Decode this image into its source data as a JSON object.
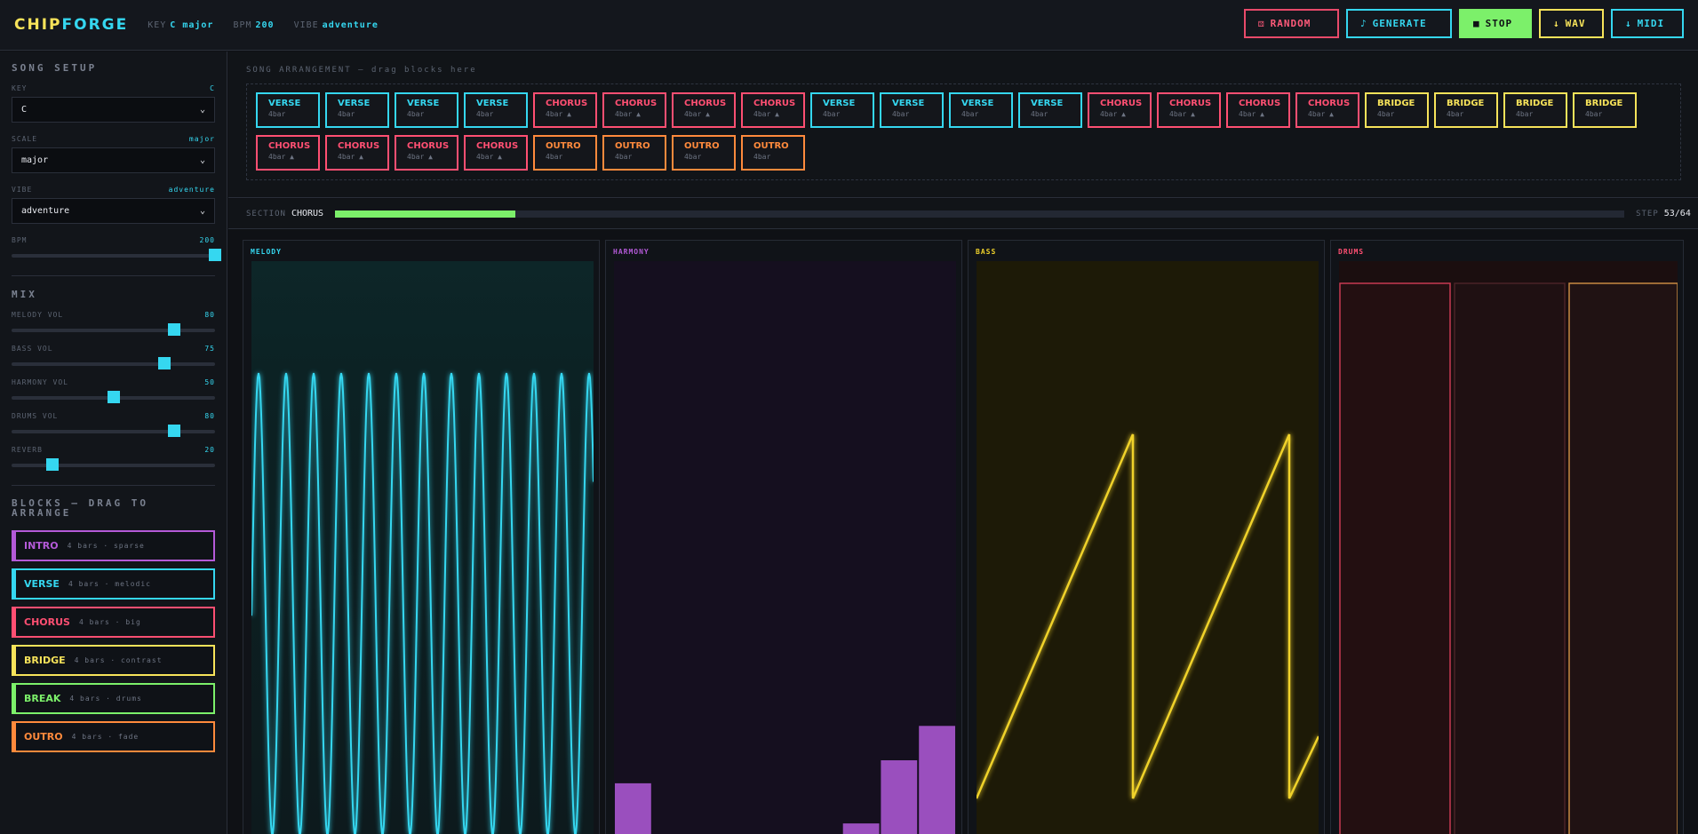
{
  "header": {
    "logo_a": "CHIP",
    "logo_b": "FORGE",
    "key_label": "KEY",
    "key_value": "C major",
    "bpm_label": "BPM",
    "bpm_value": "200",
    "vibe_label": "VIBE",
    "vibe_value": "adventure",
    "buttons": {
      "random": {
        "icon": "⚄",
        "label": "RANDOM"
      },
      "generate": {
        "icon": "♪",
        "label": "GENERATE"
      },
      "stop": {
        "icon": "■",
        "label": "STOP"
      },
      "wav": {
        "icon": "↓",
        "label": "WAV"
      },
      "midi": {
        "icon": "↓",
        "label": "MIDI"
      }
    }
  },
  "sidebar": {
    "song_setup_title": "SONG SETUP",
    "key": {
      "label": "KEY",
      "value_display": "C",
      "selected": "C"
    },
    "scale": {
      "label": "SCALE",
      "value_display": "major",
      "selected": "major"
    },
    "vibe": {
      "label": "VIBE",
      "value_display": "adventure",
      "selected": "adventure"
    },
    "bpm": {
      "label": "BPM",
      "value": "200",
      "fraction": 1.0
    },
    "mix_title": "MIX",
    "mix": [
      {
        "label": "MELODY VOL",
        "value": "80",
        "fraction": 0.8
      },
      {
        "label": "BASS VOL",
        "value": "75",
        "fraction": 0.75
      },
      {
        "label": "HARMONY VOL",
        "value": "50",
        "fraction": 0.5
      },
      {
        "label": "DRUMS VOL",
        "value": "80",
        "fraction": 0.8
      },
      {
        "label": "REVERB",
        "value": "20",
        "fraction": 0.2
      }
    ],
    "blocks_title": "BLOCKS — DRAG TO ARRANGE",
    "blocks": [
      {
        "name": "INTRO",
        "desc": "4 bars · sparse",
        "color": "#b45ad8"
      },
      {
        "name": "VERSE",
        "desc": "4 bars · melodic",
        "color": "#35d7f0"
      },
      {
        "name": "CHORUS",
        "desc": "4 bars · big",
        "color": "#ff4f72"
      },
      {
        "name": "BRIDGE",
        "desc": "4 bars · contrast",
        "color": "#f7e35a"
      },
      {
        "name": "BREAK",
        "desc": "4 bars · drums",
        "color": "#7cf06a"
      },
      {
        "name": "OUTRO",
        "desc": "4 bars · fade",
        "color": "#ff8a3c"
      }
    ]
  },
  "arrangement": {
    "title": "SONG ARRANGEMENT — drag blocks here",
    "chips": [
      {
        "name": "VERSE",
        "bars": "4bar",
        "color": "#35d7f0"
      },
      {
        "name": "VERSE",
        "bars": "4bar",
        "color": "#35d7f0"
      },
      {
        "name": "VERSE",
        "bars": "4bar",
        "color": "#35d7f0"
      },
      {
        "name": "VERSE",
        "bars": "4bar",
        "color": "#35d7f0"
      },
      {
        "name": "CHORUS",
        "bars": "4bar ▲",
        "color": "#ff4f72"
      },
      {
        "name": "CHORUS",
        "bars": "4bar ▲",
        "color": "#ff4f72"
      },
      {
        "name": "CHORUS",
        "bars": "4bar ▲",
        "color": "#ff4f72"
      },
      {
        "name": "CHORUS",
        "bars": "4bar ▲",
        "color": "#ff4f72"
      },
      {
        "name": "VERSE",
        "bars": "4bar",
        "color": "#35d7f0"
      },
      {
        "name": "VERSE",
        "bars": "4bar",
        "color": "#35d7f0"
      },
      {
        "name": "VERSE",
        "bars": "4bar",
        "color": "#35d7f0"
      },
      {
        "name": "VERSE",
        "bars": "4bar",
        "color": "#35d7f0"
      },
      {
        "name": "CHORUS",
        "bars": "4bar ▲",
        "color": "#ff4f72"
      },
      {
        "name": "CHORUS",
        "bars": "4bar ▲",
        "color": "#ff4f72"
      },
      {
        "name": "CHORUS",
        "bars": "4bar ▲",
        "color": "#ff4f72"
      },
      {
        "name": "CHORUS",
        "bars": "4bar ▲",
        "color": "#ff4f72"
      },
      {
        "name": "BRIDGE",
        "bars": "4bar",
        "color": "#f7e35a"
      },
      {
        "name": "BRIDGE",
        "bars": "4bar",
        "color": "#f7e35a"
      },
      {
        "name": "BRIDGE",
        "bars": "4bar",
        "color": "#f7e35a"
      },
      {
        "name": "BRIDGE",
        "bars": "4bar",
        "color": "#f7e35a"
      },
      {
        "name": "CHORUS",
        "bars": "4bar ▲",
        "color": "#ff4f72"
      },
      {
        "name": "CHORUS",
        "bars": "4bar ▲",
        "color": "#ff4f72"
      },
      {
        "name": "CHORUS",
        "bars": "4bar ▲",
        "color": "#ff4f72"
      },
      {
        "name": "CHORUS",
        "bars": "4bar ▲",
        "color": "#ff4f72"
      },
      {
        "name": "OUTRO",
        "bars": "4bar",
        "color": "#ff8a3c"
      },
      {
        "name": "OUTRO",
        "bars": "4bar",
        "color": "#ff8a3c"
      },
      {
        "name": "OUTRO",
        "bars": "4bar",
        "color": "#ff8a3c"
      },
      {
        "name": "OUTRO",
        "bars": "4bar",
        "color": "#ff8a3c"
      }
    ]
  },
  "status": {
    "section_label": "SECTION",
    "section_value": "CHORUS",
    "progress_fraction": 0.14,
    "step_label": "STEP",
    "step_value": "53/64"
  },
  "panels": {
    "melody": {
      "title": "MELODY",
      "color": "#35d7f0"
    },
    "harmony": {
      "title": "HARMONY",
      "color": "#b45ad8",
      "bars": [
        0.09,
        0.0,
        0.0,
        0.0,
        0.0,
        0.0,
        0.02,
        0.13,
        0.19
      ]
    },
    "bass": {
      "title": "BASS",
      "color": "#f0d22a"
    },
    "drums": {
      "title": "DRUMS",
      "color": "#ff4f72"
    }
  }
}
